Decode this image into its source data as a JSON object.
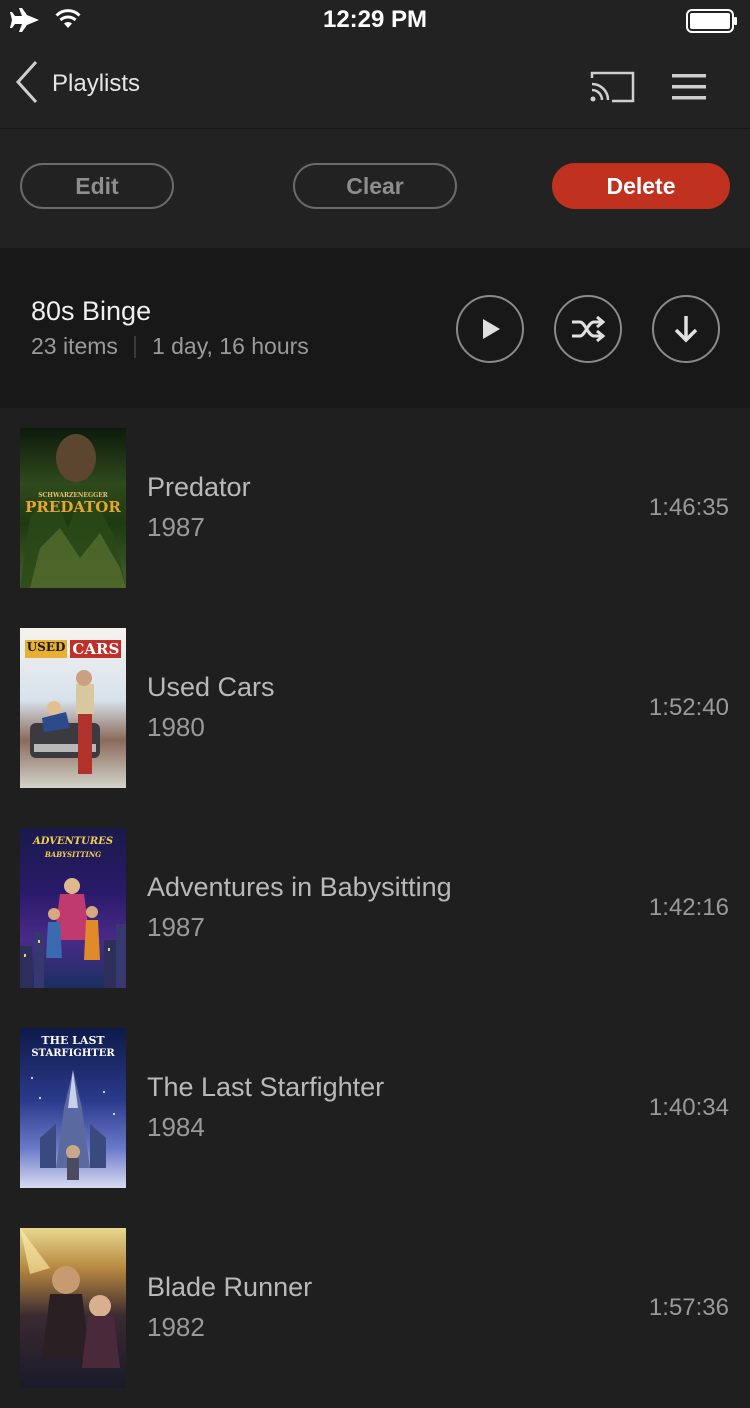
{
  "status_bar": {
    "time": "12:29 PM",
    "icons": [
      "airplane-icon",
      "wifi-icon",
      "battery-icon"
    ]
  },
  "nav": {
    "back_label": "Playlists",
    "icons": [
      "chevron-left-icon",
      "cast-icon",
      "menu-icon"
    ]
  },
  "actions": {
    "edit_label": "Edit",
    "clear_label": "Clear",
    "delete_label": "Delete"
  },
  "playlist": {
    "title": "80s Binge",
    "item_count": "23 items",
    "total_duration": "1 day, 16 hours",
    "icons": [
      "play-icon",
      "shuffle-icon",
      "download-icon"
    ]
  },
  "movies": [
    {
      "title": "Predator",
      "year": "1987",
      "duration": "1:46:35",
      "poster_text": [
        "SCHWARZENEGGER",
        "PREDATOR"
      ]
    },
    {
      "title": "Used Cars",
      "year": "1980",
      "duration": "1:52:40",
      "poster_text": [
        "USED",
        "CARS"
      ]
    },
    {
      "title": "Adventures in Babysitting",
      "year": "1987",
      "duration": "1:42:16",
      "poster_text": [
        "ADVENTURES",
        "BABYSITTING"
      ]
    },
    {
      "title": "The Last Starfighter",
      "year": "1984",
      "duration": "1:40:34",
      "poster_text": [
        "THE LAST",
        "STARFIGHTER"
      ]
    },
    {
      "title": "Blade Runner",
      "year": "1982",
      "duration": "1:57:36",
      "poster_text": []
    }
  ],
  "colors": {
    "background": "#1f1f1f",
    "bar": "#222222",
    "header": "#181818",
    "accent": "#c0311f",
    "title_text": "#b9b9b9",
    "secondary_text": "#9a9a9a"
  }
}
